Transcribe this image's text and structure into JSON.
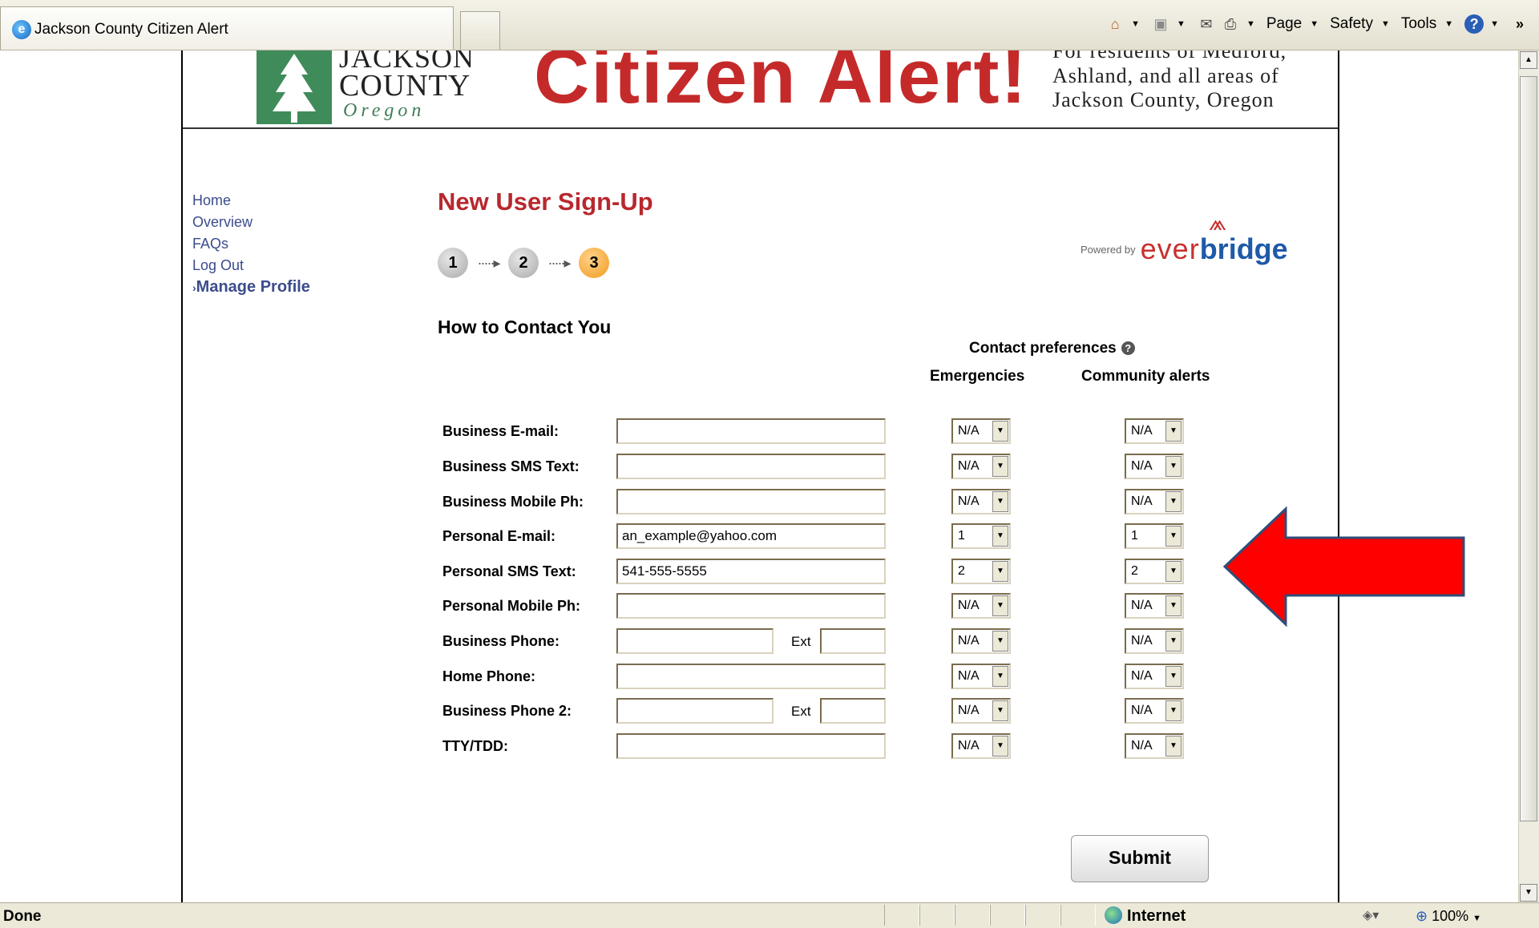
{
  "browser": {
    "tab_title": "Jackson County Citizen Alert",
    "commands": {
      "page": "Page",
      "safety": "Safety",
      "tools": "Tools"
    },
    "status": "Done",
    "zone": "Internet",
    "zoom": "100%"
  },
  "banner": {
    "logo_line1": "JACKSON",
    "logo_line2": "COUNTY",
    "logo_line3": "Oregon",
    "title": "Citizen Alert!",
    "tagline1": "For residents of Medford,",
    "tagline2": "Ashland, and all areas of",
    "tagline3": "Jackson County, Oregon"
  },
  "nav": {
    "items": [
      "Home",
      "Overview",
      "FAQs",
      "Log Out"
    ],
    "active": "Manage Profile"
  },
  "main": {
    "title": "New User Sign-Up",
    "steps": [
      "1",
      "2",
      "3"
    ],
    "current_step": "3",
    "powered_by": "Powered by",
    "brand_ever": "ever",
    "brand_bridge": "bridge",
    "section_title": "How to Contact You",
    "prefs_title": "Contact preferences",
    "col_emergencies": "Emergencies",
    "col_community": "Community alerts",
    "ext_label": "Ext",
    "submit_label": "Submit"
  },
  "rows": [
    {
      "label": "Business E-mail:",
      "value": "",
      "emerg": "N/A",
      "comm": "N/A"
    },
    {
      "label": "Business SMS Text:",
      "value": "",
      "emerg": "N/A",
      "comm": "N/A"
    },
    {
      "label": "Business Mobile Ph:",
      "value": "",
      "emerg": "N/A",
      "comm": "N/A"
    },
    {
      "label": "Personal E-mail:",
      "value": "an_example@yahoo.com",
      "emerg": "1",
      "comm": "1"
    },
    {
      "label": "Personal SMS Text:",
      "value": "541-555-5555",
      "emerg": "2",
      "comm": "2"
    },
    {
      "label": "Personal Mobile Ph:",
      "value": "",
      "emerg": "N/A",
      "comm": "N/A"
    },
    {
      "label": "Business Phone:",
      "value": "",
      "ext": "",
      "emerg": "N/A",
      "comm": "N/A"
    },
    {
      "label": "Home Phone:",
      "value": "",
      "emerg": "N/A",
      "comm": "N/A"
    },
    {
      "label": "Business Phone 2:",
      "value": "",
      "ext": "",
      "emerg": "N/A",
      "comm": "N/A"
    },
    {
      "label": "TTY/TDD:",
      "value": "",
      "emerg": "N/A",
      "comm": "N/A"
    }
  ],
  "colors": {
    "title_red": "#b8282e",
    "banner_red": "#c52a2a",
    "nav_blue": "#3c4c8c",
    "callout_red": "#ff0000"
  }
}
